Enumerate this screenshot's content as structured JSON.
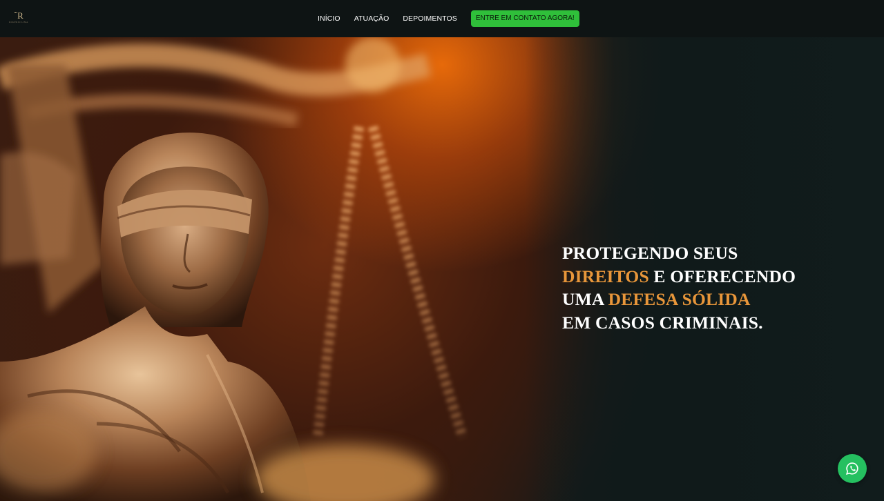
{
  "logo": {
    "mark": "R",
    "subtitle": "ROGÉRIO LIMA"
  },
  "nav": {
    "links": [
      {
        "label": "INÍCIO"
      },
      {
        "label": "ATUAÇÃO"
      },
      {
        "label": "DEPOIMENTOS"
      }
    ],
    "cta_label": "ENTRE EM CONTATO AGORA!"
  },
  "hero": {
    "line1": "PROTEGENDO SEUS",
    "line2_accent": "DIREITOS",
    "line2_rest": " E OFERECENDO",
    "line3_start": "UMA ",
    "line3_accent": "DEFESA SÓLIDA",
    "line4": "EM CASOS CRIMINAIS."
  },
  "whatsapp": {
    "icon": "whatsapp-icon"
  },
  "colors": {
    "accent": "#e8963a",
    "cta": "#2fbf3a",
    "whatsapp": "#25c060",
    "background": "#101a1a"
  }
}
